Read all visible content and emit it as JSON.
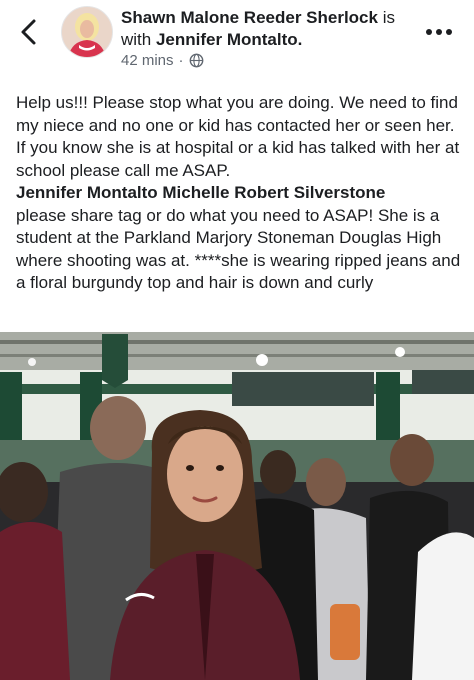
{
  "post": {
    "author": "Shawn Malone Reeder Sherlock",
    "with_word": "is with",
    "tagged": "Jennifer Montalto.",
    "time": "42 mins",
    "separator": "·",
    "icon_privacy": "globe-icon",
    "paragraph1": "Help us!!! Please stop what you are doing. We need to find my niece and no one or kid has contacted her or seen her. If you know she is at hospital or a kid has talked with her at school please call me ASAP.",
    "mentions": "Jennifer Montalto Michelle Robert Silverstone",
    "paragraph2": "please share tag or do what you need to ASAP! She is a student at the Parkland Marjory Stoneman Douglas High where shooting was at. ****she is wearing ripped jeans and a floral burgundy top and hair is down and curly"
  },
  "icons": {
    "back": "chevron-left-icon",
    "more": "more-dots-icon"
  },
  "colors": {
    "text": "#1c1e21",
    "meta": "#606770",
    "gym_wall": "#e9ece6",
    "gym_green": "#1d4a34",
    "jacket": "#5a1e2a"
  }
}
